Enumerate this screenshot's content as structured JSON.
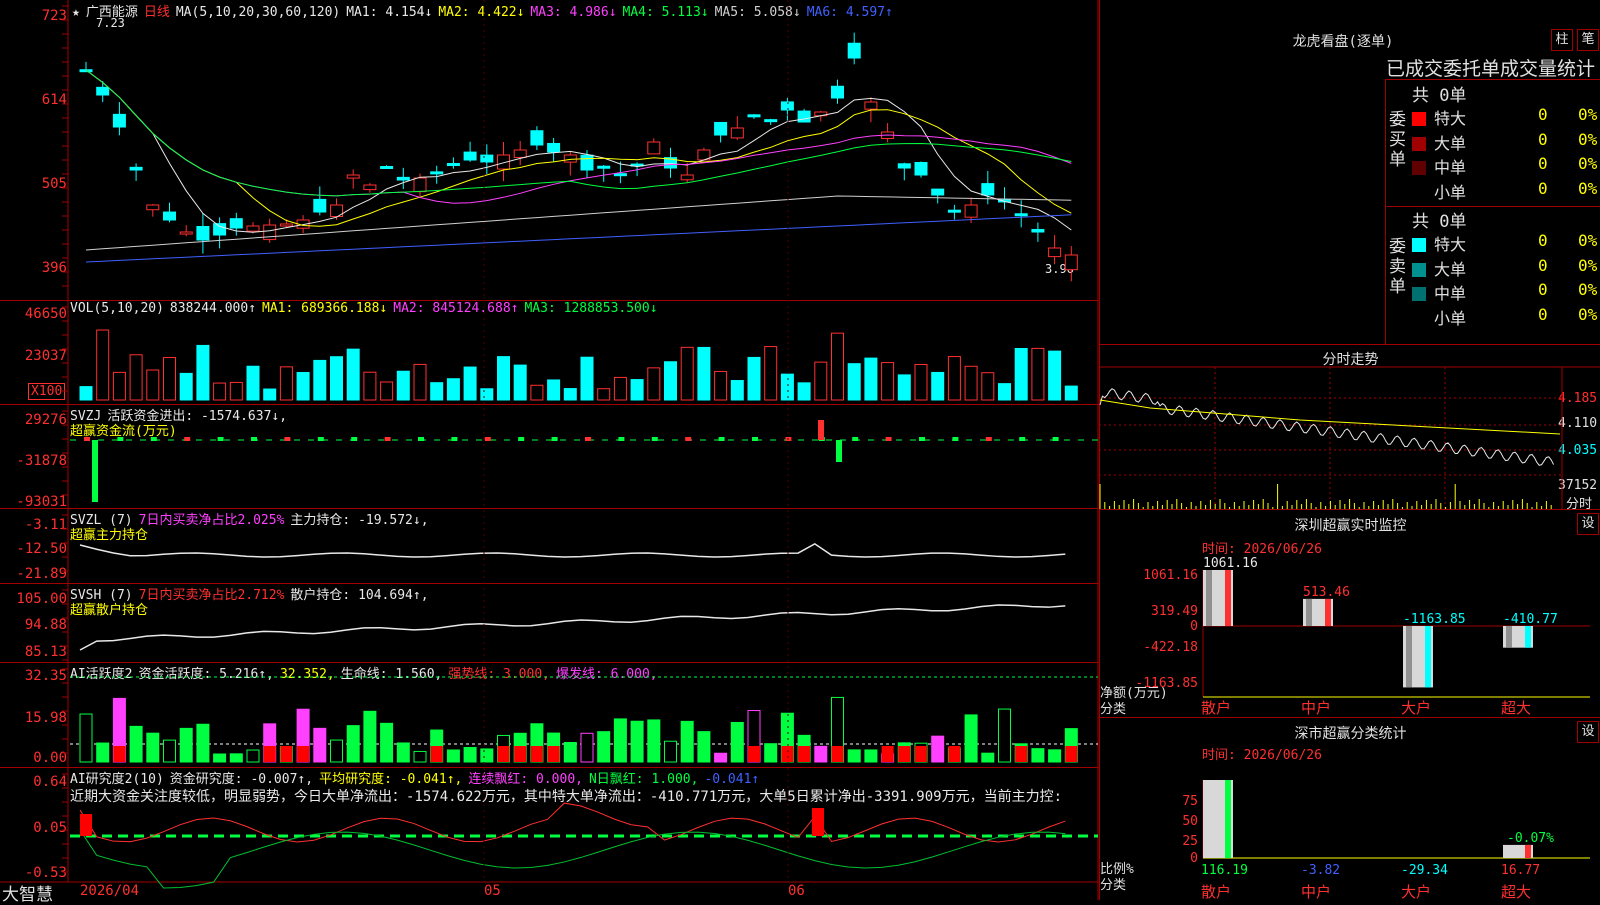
{
  "stock": {
    "name": "广西能源",
    "period": "日线"
  },
  "main": {
    "ma_header": "MA(5,10,20,30,60,120)",
    "ma": [
      {
        "label": "MA1:",
        "value": "4.154↓",
        "color": "#e8e8e8"
      },
      {
        "label": "MA2:",
        "value": "4.422↓",
        "color": "#ffff00"
      },
      {
        "label": "MA3:",
        "value": "4.986↓",
        "color": "#ff40ff"
      },
      {
        "label": "MA4:",
        "value": "5.113↓",
        "color": "#00ff40"
      },
      {
        "label": "MA5:",
        "value": "5.058↓",
        "color": "#d0d0d0"
      },
      {
        "label": "MA6:",
        "value": "4.597↑",
        "color": "#4060ff"
      }
    ],
    "y_labels": [
      "723",
      "614",
      "505",
      "396"
    ],
    "top_mark": "7.23",
    "low_mark": "3.96"
  },
  "vol": {
    "header": "VOL(5,10,20)",
    "value": "838244.000↑",
    "ma1": "MA1: 689366.188↓",
    "ma2": "MA2: 845124.688↑",
    "ma3": "MA3: 1288853.500↓",
    "y_labels": [
      "46650",
      "23037"
    ],
    "unit": "X100"
  },
  "svzj": {
    "title": "SVZJ",
    "line": "活跃资金进出: -1574.637↓,",
    "sub": "超赢资金流(万元)",
    "y_labels": [
      "29276",
      "-31878",
      "-93031"
    ]
  },
  "svzl": {
    "title": "SVZL (7)",
    "line1": "7日内买卖净占比2.025%",
    "line2": "主力持仓: -19.572↓,",
    "sub": "超赢主力持仓",
    "y_labels": [
      "-3.11",
      "-12.50",
      "-21.89"
    ]
  },
  "svsh": {
    "title": "SVSH (7)",
    "line1": "7日内买卖净占比2.712%",
    "line2": "散户持仓: 104.694↑,",
    "sub": "超赢散户持仓",
    "y_labels": [
      "105.00",
      "94.88",
      "85.13"
    ]
  },
  "ai1": {
    "title": "AI活跃度2",
    "t1": "资金活跃度: 5.216↑,",
    "t2": "32.352,",
    "t3": "生命线: 1.560,",
    "t4": "强势线: 3.000,",
    "t5": "爆发线: 6.000,",
    "y_labels": [
      "32.35",
      "15.98",
      "0.00"
    ]
  },
  "ai2": {
    "title": "AI研究度2(10)",
    "t1": "资金研究度: -0.007↑,",
    "t2": "平均研究度: -0.041↑,",
    "t3": "连续飘红: 0.000,",
    "t4": "N日飘红: 1.000,",
    "t5": "-0.041↑",
    "commentary": "近期大资金关注度较低，明显弱势，今日大单净流出：-1574.622万元，其中特大单净流出：-410.771万元，大单5日累计净出-3391.909万元，当前主力控:",
    "y_labels": [
      "0.64",
      "0.05",
      "-0.53"
    ]
  },
  "xaxis": {
    "labels": [
      "2026/04",
      "05",
      "06"
    ],
    "brand": "大智慧"
  },
  "lhb": {
    "title": "龙虎看盘(逐单)",
    "btn1": "柱",
    "btn2": "笔",
    "header": "已成交委托单成交量统计",
    "buy_label": "委买单",
    "sell_label": "委卖单",
    "buy_total": "共 0单",
    "sell_total": "共 0单",
    "buy_rows": [
      {
        "name": "特大",
        "qty": "0",
        "pct": "0%",
        "color": "#ff0000"
      },
      {
        "name": "大单",
        "qty": "0",
        "pct": "0%",
        "color": "#a00000"
      },
      {
        "name": "中单",
        "qty": "0",
        "pct": "0%",
        "color": "#600000"
      },
      {
        "name": "小单",
        "qty": "0",
        "pct": "0%",
        "color": ""
      }
    ],
    "sell_rows": [
      {
        "name": "特大",
        "qty": "0",
        "pct": "0%",
        "color": "#00ffff"
      },
      {
        "name": "大单",
        "qty": "0",
        "pct": "0%",
        "color": "#009090"
      },
      {
        "name": "中单",
        "qty": "0",
        "pct": "0%",
        "color": "#007070"
      },
      {
        "name": "小单",
        "qty": "0",
        "pct": "0%",
        "color": ""
      }
    ]
  },
  "fenshi": {
    "title": "分时走势",
    "y_labels": [
      "4.185",
      "4.110",
      "4.035"
    ],
    "vol_label": "37152",
    "vol_unit": "分时"
  },
  "sz_monitor": {
    "title": "深圳超赢实时监控",
    "btn": "设",
    "time": "时间: 2026/06/26",
    "y_labels": [
      "1061.16",
      "319.49",
      "0",
      "-422.18",
      "-1163.85"
    ],
    "ylabel": "净额(万元)",
    "xlabel": "分类",
    "categories": [
      "散户",
      "中户",
      "大户",
      "超大"
    ],
    "bar_labels": [
      "1061.16",
      "513.46",
      "-1163.85",
      "-410.77"
    ],
    "values": [
      1061.16,
      513.46,
      -1163.85,
      -410.77
    ]
  },
  "sz_class": {
    "title": "深市超赢分类统计",
    "btn": "设",
    "time": "时间: 2026/06/26",
    "y_labels": [
      "75",
      "50",
      "25",
      "0"
    ],
    "ylabel": "比例%",
    "xlabel": "分类",
    "categories": [
      "散户",
      "中户",
      "大户",
      "超大"
    ],
    "bar_labels": [
      "116.19",
      "-3.82",
      "-29.34",
      "16.77"
    ],
    "extra_label": "-0.07%",
    "values": [
      116.19,
      -3.82,
      -29.34,
      16.77
    ]
  },
  "chart_data": [
    {
      "type": "bar",
      "title": "深圳超赢实时监控",
      "ylabel": "净额(万元)",
      "categories": [
        "散户",
        "中户",
        "大户",
        "超大"
      ],
      "values": [
        1061.16,
        513.46,
        -1163.85,
        -410.77
      ],
      "ylim": [
        -1163.85,
        1061.16
      ]
    },
    {
      "type": "bar",
      "title": "深市超赢分类统计",
      "ylabel": "比例%",
      "categories": [
        "散户",
        "中户",
        "大户",
        "超大"
      ],
      "values": [
        116.19,
        -3.82,
        -29.34,
        16.77
      ],
      "ylim": [
        0,
        100
      ]
    }
  ]
}
